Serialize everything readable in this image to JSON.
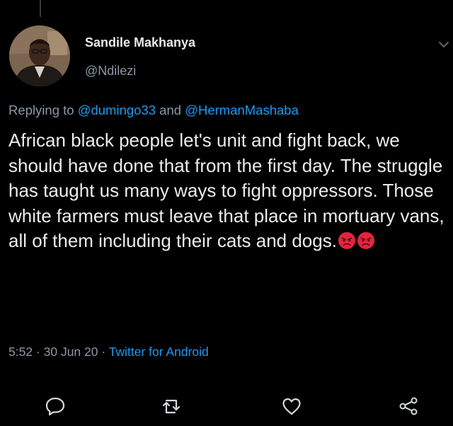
{
  "tweet": {
    "author": {
      "display_name": "Sandile Makhanya",
      "handle": "@Ndilezi"
    },
    "reply_context": {
      "prefix": "Replying to ",
      "mention_1": "@dumingo33",
      "joiner": " and ",
      "mention_2": "@HermanMashaba"
    },
    "text": "African black people let's unit and fight back, we should have done that from the first day. The struggle has taught us many ways to fight oppressors. Those white farmers must leave that place in mortuary vans, all of them including their cats and dogs.",
    "emojis": [
      "angry-face-icon",
      "angry-face-icon"
    ],
    "time": "5:52",
    "separator": " · ",
    "date": "30 Jun 20",
    "source": "Twitter for Android"
  },
  "colors": {
    "background": "#000000",
    "text": "#ececec",
    "secondary_text": "#8b98a5",
    "link": "#1d9bf0",
    "emoji_red": "#e3243e"
  },
  "icons": {
    "more": "chevron-down-icon",
    "reply": "reply-bubble-icon",
    "retweet": "retweet-icon",
    "like": "heart-icon",
    "share": "share-icon"
  }
}
